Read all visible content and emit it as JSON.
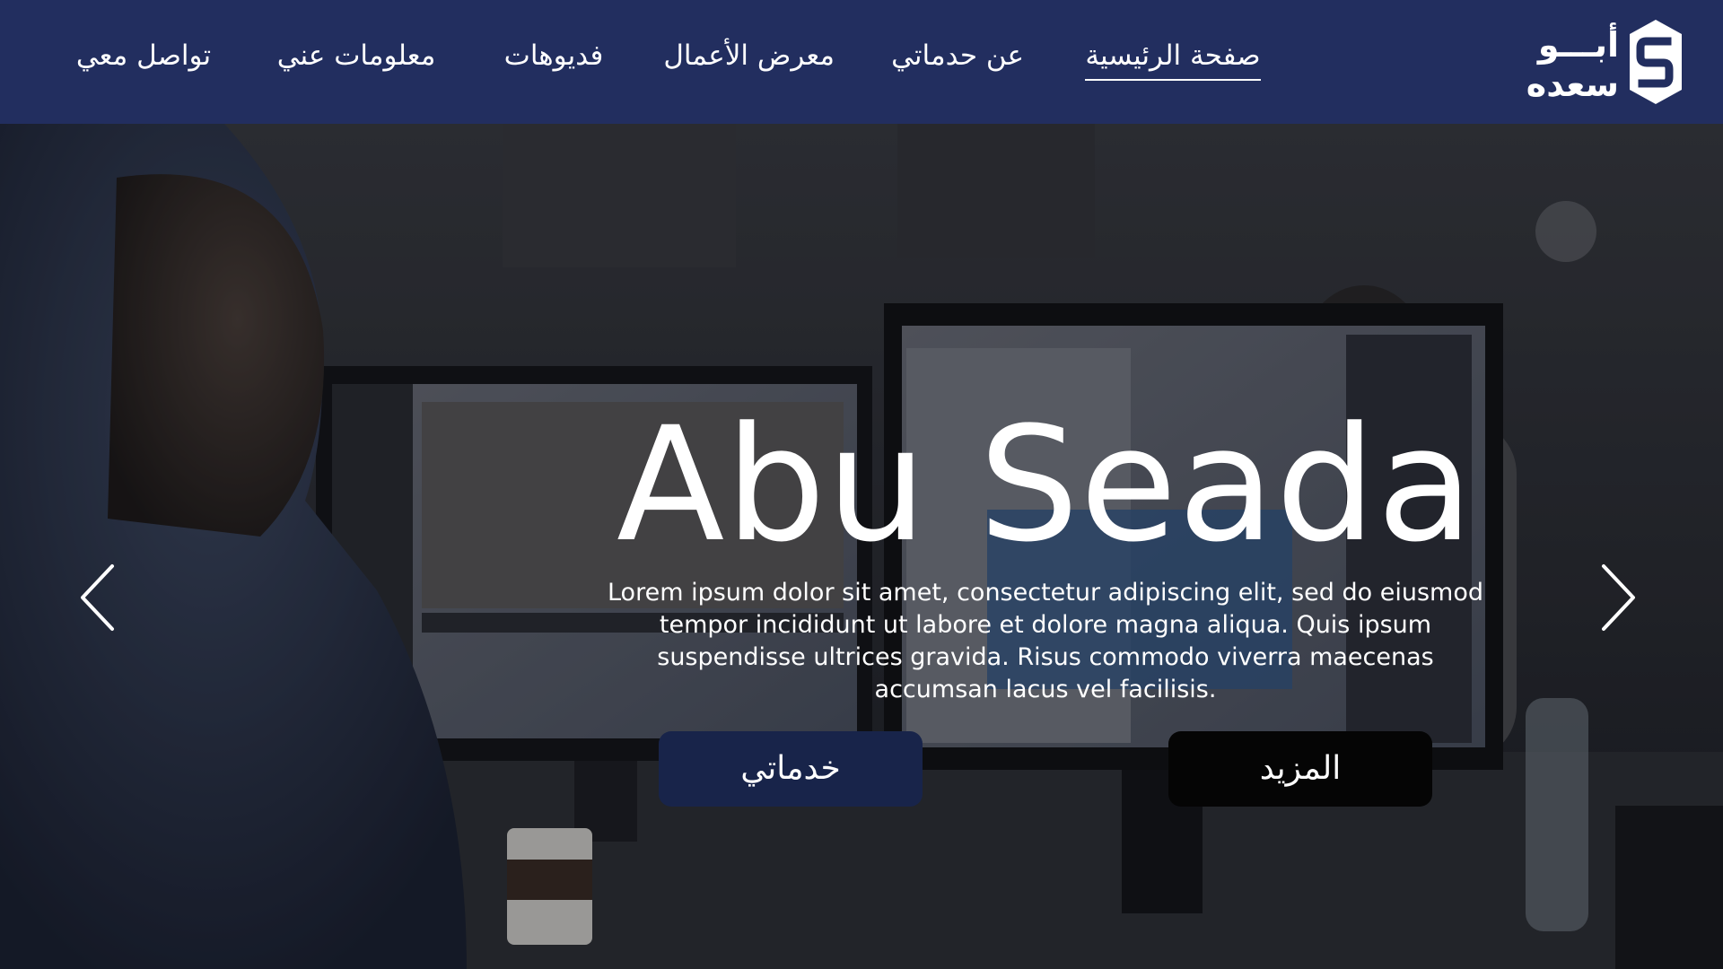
{
  "nav": {
    "items": [
      {
        "label": "صفحة الرئيسية",
        "active": true
      },
      {
        "label": "عن حدماتي",
        "active": false
      },
      {
        "label": "معرض الأعمال",
        "active": false
      },
      {
        "label": "فديوهات",
        "active": false
      },
      {
        "label": "معلومات عني",
        "active": false
      },
      {
        "label": "تواصل معي",
        "active": false
      }
    ]
  },
  "logo": {
    "mark_letter": "S",
    "top_text": "أبـــو",
    "bottom_text": "سعده"
  },
  "hero": {
    "title": "Abu Seada",
    "description": "Lorem ipsum dolor sit amet, consectetur adipiscing elit, sed do eiusmod tempor incididunt ut labore et dolore magna aliqua. Quis ipsum suspendisse ultrices gravida. Risus commodo viverra maecenas accumsan lacus vel facilisis.",
    "primary_button": "خدماتي",
    "secondary_button": "المزيد",
    "prev_icon": "chevron-left-icon",
    "next_icon": "chevron-right-icon"
  },
  "colors": {
    "navbar": "#222e5f",
    "primary_button": "#18244a",
    "secondary_button": "#050505",
    "text": "#ffffff"
  }
}
